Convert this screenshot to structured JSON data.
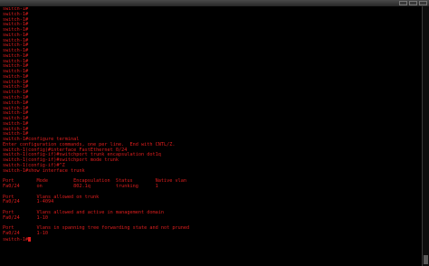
{
  "window": {
    "title": "",
    "accent": "#e01e1e",
    "background": "#000000"
  },
  "terminal": {
    "lines": [
      "switch-1#",
      "switch-1#",
      "switch-1#",
      "switch-1#",
      "switch-1#",
      "switch-1#",
      "switch-1#",
      "switch-1#",
      "switch-1#",
      "switch-1#",
      "switch-1#",
      "switch-1#",
      "switch-1#",
      "switch-1#",
      "switch-1#",
      "switch-1#",
      "switch-1#",
      "switch-1#",
      "switch-1#",
      "switch-1#",
      "switch-1#",
      "switch-1#",
      "switch-1#",
      "switch-1#",
      "switch-1#",
      "switch-1#configure terminal",
      "Enter configuration commands, one per line.  End with CNTL/Z.",
      "switch-1(config)#interface FastEthernet 0/24",
      "switch-1(config-if)#switchport trunk encapsulation dot1q",
      "switch-1(config-if)#switchport mode trunk",
      "switch-1(config-if)#^Z",
      "switch-1#show interface trunk",
      "",
      "Port        Mode         Encapsulation  Status        Native vlan",
      "Fa0/24      on           802.1q         trunking      1",
      "",
      "Port        Vlans allowed on trunk",
      "Fa0/24      1-4094",
      "",
      "Port        Vlans allowed and active in management domain",
      "Fa0/24      1-10",
      "",
      "Port        Vlans in spanning tree forwarding state and not pruned",
      "Fa0/24      1-10",
      "switch-1#"
    ]
  }
}
